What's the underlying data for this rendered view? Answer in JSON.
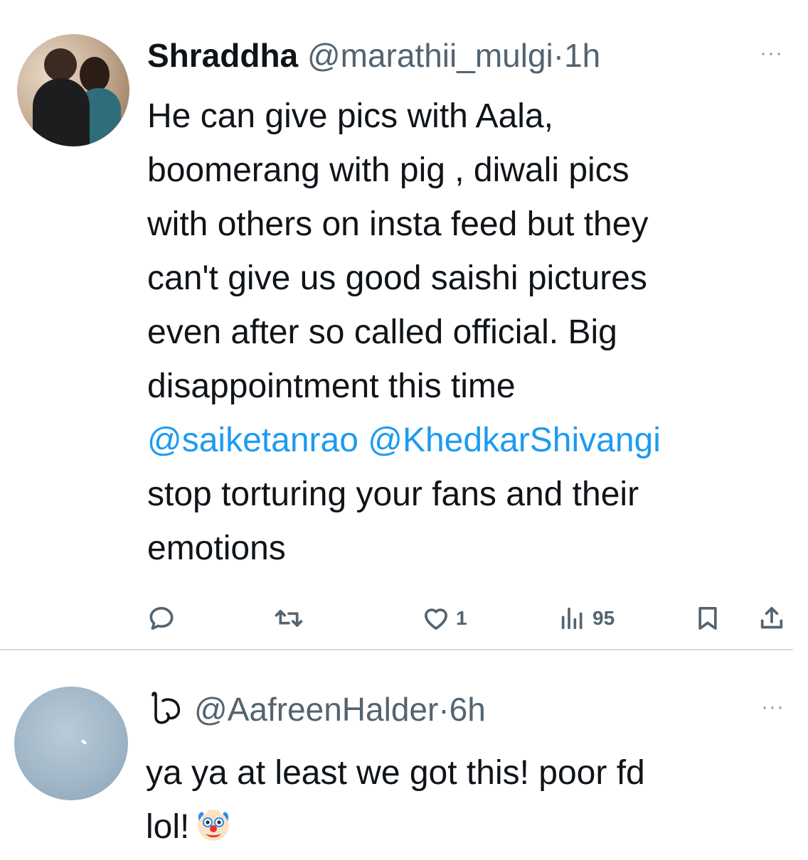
{
  "tweet": {
    "author_name": "Shraddha",
    "author_handle": "@marathii_mulgi",
    "separator": "·",
    "time": "1h",
    "more_label": "···",
    "lines": [
      "He can give pics with Aala,",
      "boomerang with pig , diwali pics",
      "with others on insta feed but they",
      "can't give us good saishi pictures",
      "even after so called official. Big",
      "disappointment this time"
    ],
    "mention_1": "@saiketanrao",
    "mention_2": "@KhedkarShivangi",
    "lines_after": [
      "stop torturing your fans and their",
      "emotions"
    ],
    "actions": {
      "reply_icon": "reply-icon",
      "retweet_icon": "retweet-icon",
      "like_icon": "heart-icon",
      "like_count": "1",
      "views_icon": "views-icon",
      "views_count": "95",
      "bookmark_icon": "bookmark-icon",
      "share_icon": "share-icon"
    }
  },
  "reply": {
    "author_handle": "@AafreenHalder",
    "separator": "·",
    "time": "6h",
    "more_label": "···",
    "lines": [
      "ya ya at least we got this! poor fd"
    ],
    "last_line": "lol!",
    "emoji_icon": "clown-face-icon"
  },
  "colors": {
    "text": "#0f1419",
    "secondary": "#536471",
    "mention": "#1d9bf0",
    "divider": "#d5dbe0"
  }
}
